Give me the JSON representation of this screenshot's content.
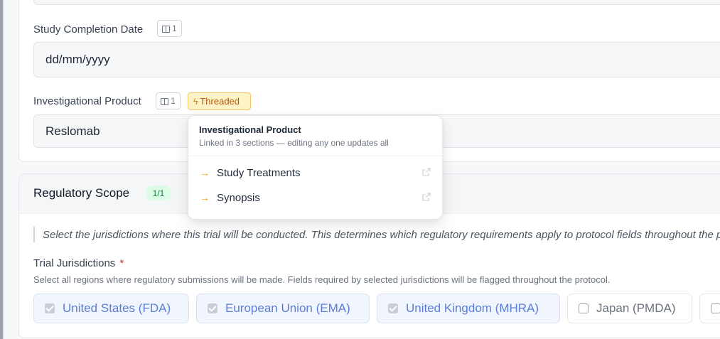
{
  "fields": {
    "completion_date": {
      "label": "Study Completion Date",
      "ref_count": "1",
      "placeholder": "dd/mm/yyyy"
    },
    "investigational_product": {
      "label": "Investigational Product",
      "ref_count": "1",
      "badge": "Threaded",
      "value": "Reslomab"
    }
  },
  "popover": {
    "title": "Investigational Product",
    "subtitle": "Linked in 3 sections — editing any one updates all",
    "items": [
      {
        "label": "Study Treatments"
      },
      {
        "label": "Synopsis"
      }
    ]
  },
  "regulatory": {
    "title": "Regulatory Scope",
    "count": "1/1",
    "note": "Select the jurisdictions where this trial will be conducted. This determines which regulatory requirements apply to protocol fields throughout the protocol.",
    "jurisdictions_label": "Trial Jurisdictions",
    "required_mark": "*",
    "help": "Select all regions where regulatory submissions will be made. Fields required by selected jurisdictions will be flagged throughout the protocol.",
    "options": [
      {
        "label": "United States (FDA)",
        "checked": true
      },
      {
        "label": "European Union (EMA)",
        "checked": true
      },
      {
        "label": "United Kingdom (MHRA)",
        "checked": true
      },
      {
        "label": "Japan (PMDA)",
        "checked": false
      },
      {
        "label": "",
        "checked": false
      }
    ]
  },
  "colors": {
    "accent": "#5b7fd6",
    "threaded_bg": "#fef3c7",
    "threaded_text": "#b45309",
    "count_bg": "#dcfce7",
    "count_text": "#15803d",
    "required": "#dc2626"
  }
}
